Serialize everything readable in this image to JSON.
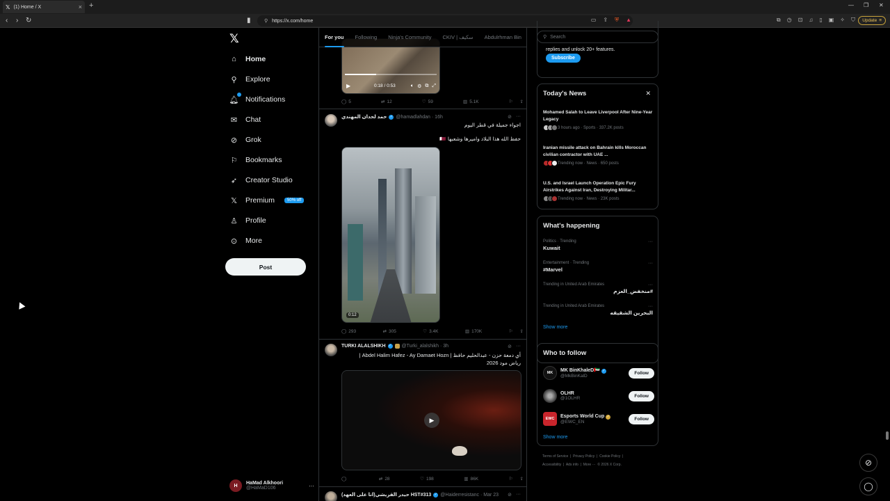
{
  "browser": {
    "tab_title": "(1) Home / X",
    "url": "https://x.com/home",
    "update_label": "Update"
  },
  "nav": {
    "items": [
      {
        "label": "Home"
      },
      {
        "label": "Explore"
      },
      {
        "label": "Notifications"
      },
      {
        "label": "Chat"
      },
      {
        "label": "Grok"
      },
      {
        "label": "Bookmarks"
      },
      {
        "label": "Creator Studio"
      },
      {
        "label": "Premium"
      },
      {
        "label": "Profile"
      },
      {
        "label": "More"
      }
    ],
    "premium_badge": "50% off",
    "post_label": "Post",
    "notifications_count": "1"
  },
  "account": {
    "name": "HaMad Alkhoori",
    "handle": "@HaMaD106"
  },
  "feed": {
    "tabs": [
      "For you",
      "Following",
      "Ninja's Community",
      "CKIV | سكيف",
      "Abdulrhman Bin"
    ],
    "tweet0": {
      "time": "0:18 / 0:53",
      "replies": "5",
      "reposts": "12",
      "likes": "59",
      "views": "5.1K"
    },
    "tweet1": {
      "name": "حمد لحدان المهندي",
      "handle": "@hamadlahdan · 16h",
      "line1": "اجواء جميلة في قطر اليوم",
      "line2": "حفظ الله هذا البلاد وامیرها وشعبها 🇶🇦",
      "duration": "0:12",
      "replies": "293",
      "reposts": "305",
      "likes": "3.4K",
      "views": "170K"
    },
    "tweet2": {
      "name": "TURKI ALALSHIKH",
      "handle": "@Turki_alalshikh · 3h",
      "line1": "أي دمعة حزن - عبدالحليم حافظ | Abdel Halim Hafez - Ay Damaet Hozn |",
      "line2": "رياض مود 2026",
      "replies": "",
      "reposts": "28",
      "likes": "198",
      "views": "86K"
    },
    "tweet3": {
      "name": "حيدر القريشي(انا على العهد) HST#313",
      "handle": "@Haiderresistanc · Mar 23"
    }
  },
  "right": {
    "search_placeholder": "Search",
    "subscribe_text": "replies and unlock 20+ features.",
    "subscribe_label": "Subscribe",
    "today_news_title": "Today's News",
    "news": [
      {
        "title": "Mohamed Salah to Leave Liverpool After Nine-Year Legacy",
        "meta": "3 hours ago · Sports · 337.2K posts"
      },
      {
        "title": "Iranian missile attack on Bahrain kills Moroccan civilian contractor with UAE ...",
        "meta": "Trending now · News · 650 posts"
      },
      {
        "title": "U.S. and Israel Launch Operation Epic Fury Airstrikes Against Iran, Destroying Militar...",
        "meta": "Trending now · News · 23K posts"
      }
    ],
    "happening_title": "What's happening",
    "trends": [
      {
        "category": "Politics · Trending",
        "name": "Kuwait"
      },
      {
        "category": "Entertainment · Trending",
        "name": "#Marvel"
      },
      {
        "category": "Trending in United Arab Emirates",
        "name": "#منخفض_العزم"
      },
      {
        "category": "Trending in United Arab Emirates",
        "name": "البحرين الشقيقه"
      }
    ],
    "show_more": "Show more",
    "wtf_title": "Who to follow",
    "follow_label": "Follow",
    "suggestions": [
      {
        "name": "MK BinKhaleD🇦🇪",
        "handle": "@MkBinKalD",
        "avatar_text": "MK"
      },
      {
        "name": "OLHR",
        "handle": "@1OLHR",
        "avatar_text": ""
      },
      {
        "name": "Esports World Cup",
        "handle": "@EWC_EN",
        "avatar_text": "EWC"
      }
    ],
    "footer": [
      "Terms of Service",
      "Privacy Policy",
      "Cookie Policy",
      "Accessibility",
      "Ads info",
      "More ···",
      "© 2026 X Corp."
    ]
  }
}
